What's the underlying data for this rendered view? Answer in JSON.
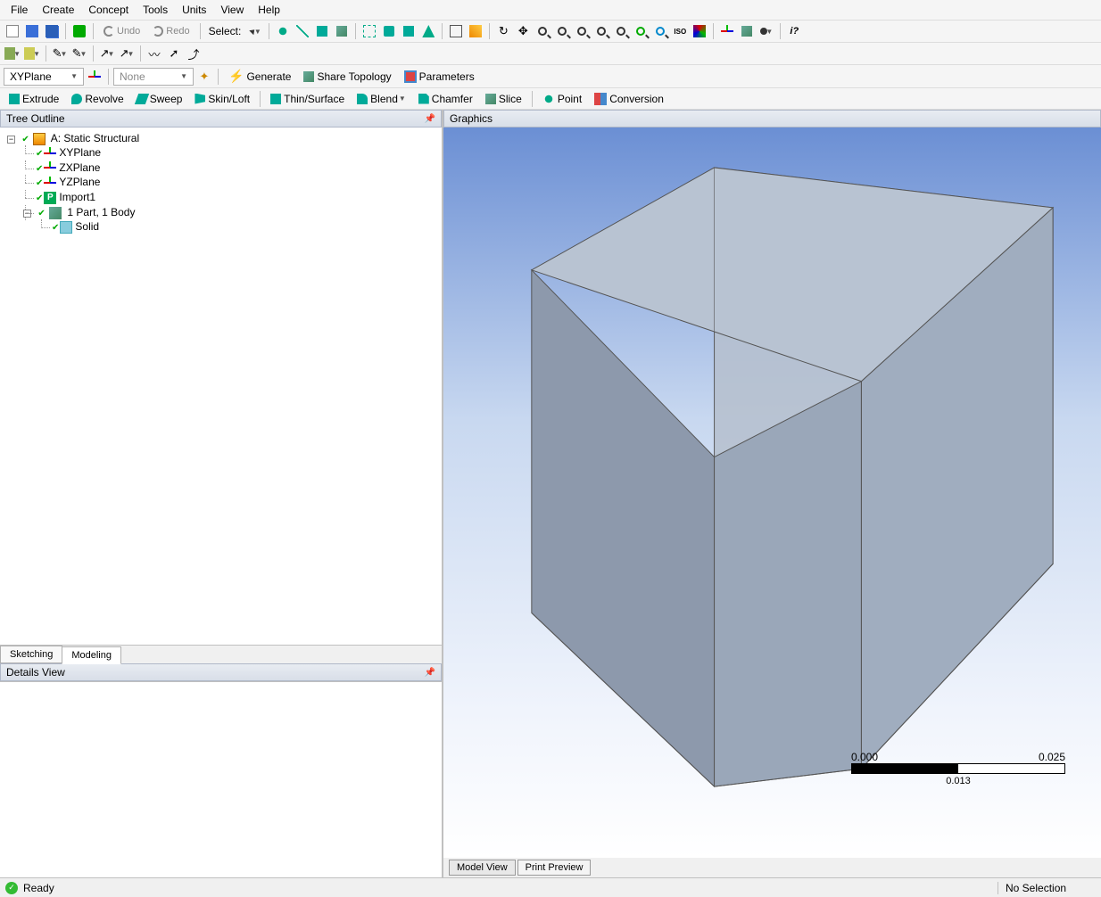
{
  "menu": {
    "file": "File",
    "create": "Create",
    "concept": "Concept",
    "tools": "Tools",
    "units": "Units",
    "view": "View",
    "help": "Help"
  },
  "toolbar1": {
    "undo": "Undo",
    "redo": "Redo",
    "select": "Select:"
  },
  "toolbar3": {
    "plane": "XYPlane",
    "sketch": "None",
    "generate": "Generate",
    "share": "Share Topology",
    "params": "Parameters"
  },
  "toolbar4": {
    "extrude": "Extrude",
    "revolve": "Revolve",
    "sweep": "Sweep",
    "skinloft": "Skin/Loft",
    "thin": "Thin/Surface",
    "blend": "Blend",
    "chamfer": "Chamfer",
    "slice": "Slice",
    "point": "Point",
    "conversion": "Conversion"
  },
  "panels": {
    "tree": "Tree Outline",
    "details": "Details View",
    "graphics": "Graphics"
  },
  "tree": {
    "root": "A: Static Structural",
    "xy": "XYPlane",
    "zx": "ZXPlane",
    "yz": "YZPlane",
    "import": "Import1",
    "parts": "1 Part, 1 Body",
    "solid": "Solid"
  },
  "subtabs": {
    "sketching": "Sketching",
    "modeling": "Modeling"
  },
  "viewtabs": {
    "model": "Model View",
    "print": "Print Preview"
  },
  "scale": {
    "start": "0.000",
    "end": "0.025",
    "mid": "0.013"
  },
  "status": {
    "ready": "Ready",
    "selection": "No Selection"
  }
}
